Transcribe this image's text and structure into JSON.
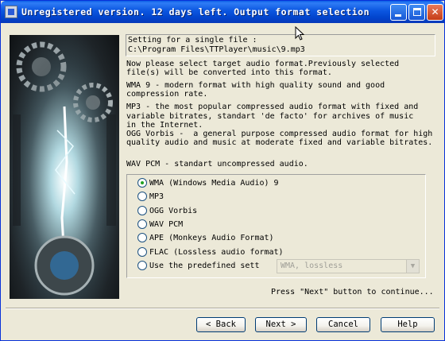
{
  "window": {
    "title": "Unregistered version. 12 days left. Output format selection",
    "min_glyph": "",
    "max_glyph": "",
    "close_glyph": "✕"
  },
  "path": {
    "line1": "Setting for a single file :",
    "line2": "C:\\Program Files\\TTPlayer\\music\\9.mp3"
  },
  "description": [
    "Now please select target audio format.Previously selected",
    "file(s) will be converted into this format.",
    "WMA 9 - modern format with high quality sound and good",
    "compression rate.",
    "MP3 - the most popular compressed audio format with fixed and",
    "variable bitrates, standart 'de facto' for archives of music",
    "in the Internet.",
    "OGG Vorbis -  a general purpose compressed audio format for high",
    "quality audio and music at moderate fixed and variable bitrates.",
    "WAV PCM - standart uncompressed audio."
  ],
  "formats": [
    {
      "label": "WMA (Windows Media Audio) 9",
      "checked": true
    },
    {
      "label": "MP3",
      "checked": false
    },
    {
      "label": "OGG Vorbis",
      "checked": false
    },
    {
      "label": "WAV PCM",
      "checked": false
    },
    {
      "label": "APE (Monkeys Audio Format)",
      "checked": false
    },
    {
      "label": "FLAC (Lossless audio format)",
      "checked": false
    },
    {
      "label": "Use the predefined sett",
      "checked": false
    }
  ],
  "predefined_select": {
    "value": "WMA, lossless",
    "disabled": true
  },
  "hint": "Press \"Next\" button to continue...",
  "buttons": {
    "back": "< Back",
    "next": "Next >",
    "cancel": "Cancel",
    "help": "Help"
  },
  "colors": {
    "title_bar": "#0b56e0",
    "face": "#ece9d8",
    "radio_dot": "#21a121"
  }
}
